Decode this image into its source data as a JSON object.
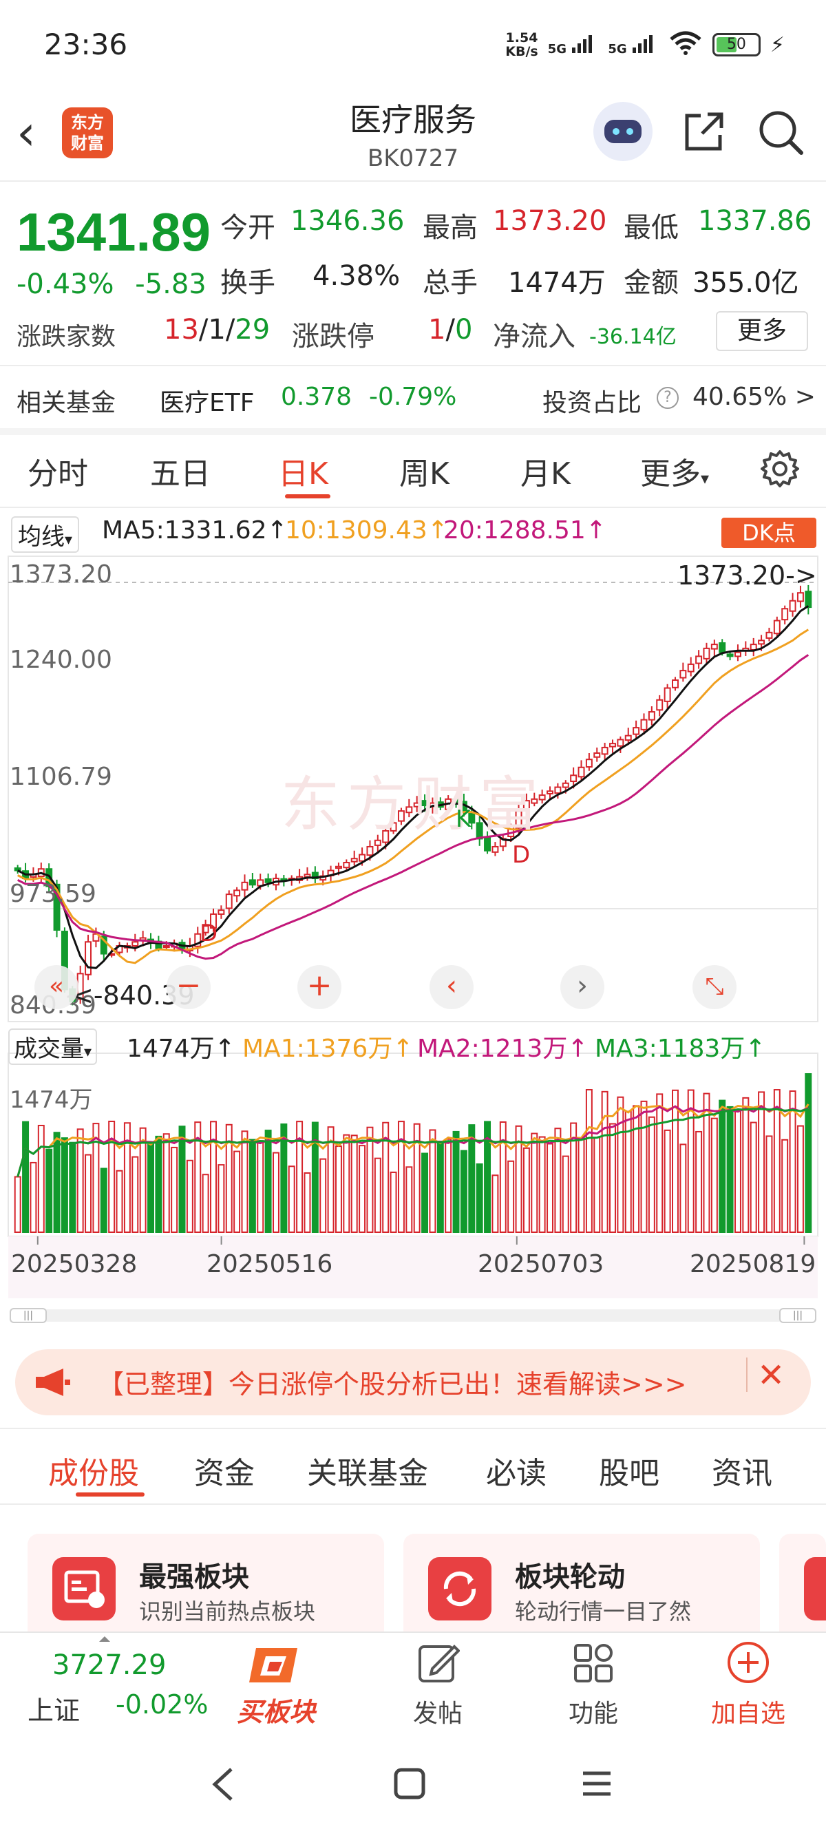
{
  "status_bar": {
    "time": "23:36",
    "net_speed_value": "1.54",
    "net_speed_unit": "KB/s",
    "signal1": "5G",
    "signal2": "5G",
    "battery": "50"
  },
  "header": {
    "logo_line1": "东方",
    "logo_line2": "财富",
    "title": "医疗服务",
    "code": "BK0727"
  },
  "quote": {
    "price": "1341.89",
    "change_pct": "-0.43%",
    "change_abs": "-5.83",
    "open_label": "今开",
    "open": "1346.36",
    "high_label": "最高",
    "high": "1373.20",
    "low_label": "最低",
    "low": "1337.86",
    "turnover_label": "换手",
    "turnover": "4.38%",
    "volume_label": "总手",
    "volume": "1474万",
    "amount_label": "金额",
    "amount": "355.0亿",
    "breadth_label": "涨跌家数",
    "breadth_up": "13",
    "breadth_flat": "1",
    "breadth_down": "29",
    "limit_label": "涨跌停",
    "limit_up": "1",
    "limit_down": "0",
    "netflow_label": "净流入",
    "netflow": "-36.14亿",
    "more_button": "更多"
  },
  "fund": {
    "label": "相关基金",
    "name": "医疗ETF",
    "price": "0.378",
    "change": "-0.79%",
    "ratio_label": "投资占比",
    "ratio": "40.65%",
    "chevron": ">"
  },
  "period_tabs": [
    "分时",
    "五日",
    "日K",
    "周K",
    "月K",
    "更多"
  ],
  "ma": {
    "type": "均线",
    "ma5": "MA5:1331.62",
    "ma10": "10:1309.43",
    "ma20": "20:1288.51",
    "dk_button": "DK点",
    "colors": {
      "ma5": "#111111",
      "ma10": "#f0a020",
      "ma20": "#c2187a"
    }
  },
  "price_axis": [
    "1373.20",
    "1240.00",
    "1106.79",
    "973.59",
    "840.39"
  ],
  "chart_annotations": {
    "high_marker": "1373.20->",
    "low_marker": "<-840.39",
    "k_marker": "K",
    "d_marker1": "D",
    "d_marker2": "D",
    "watermark": "东方财富"
  },
  "volume": {
    "label": "成交量",
    "value": "1474万",
    "ma1": "MA1:1376万",
    "ma2": "MA2:1213万",
    "ma3": "MA3:1183万",
    "axis_top": "1474万",
    "colors": {
      "ma1": "#f0a020",
      "ma2": "#c2187a",
      "ma3": "#119a2d"
    }
  },
  "date_axis": [
    "20250328",
    "20250516",
    "20250703",
    "20250819"
  ],
  "banner": {
    "text": "【已整理】今日涨停个股分析已出！速看解读>>>"
  },
  "bottom_tabs": [
    "成份股",
    "资金",
    "关联基金",
    "必读",
    "股吧",
    "资讯"
  ],
  "cards": [
    {
      "title": "最强板块",
      "desc": "识别当前热点板块"
    },
    {
      "title": "板块轮动",
      "desc": "轮动行情一目了然"
    }
  ],
  "toolbar": {
    "index_value": "3727.29",
    "index_name": "上证",
    "index_change": "-0.02%",
    "buy_label": "买板块",
    "post_label": "发帖",
    "func_label": "功能",
    "add_label": "加自选"
  },
  "chart_data": {
    "type": "candlestick",
    "title": "医疗服务 日K",
    "y_axis_ticks": [
      1373.2,
      1240.0,
      1106.79,
      973.59,
      840.39
    ],
    "ylim": [
      840.39,
      1373.2
    ],
    "x_tick_labels": [
      "20250328",
      "20250516",
      "20250703",
      "20250819"
    ],
    "close_approx": [
      1010,
      1000,
      1005,
      1012,
      990,
      935,
      860,
      845,
      880,
      920,
      930,
      905,
      905,
      915,
      915,
      920,
      925,
      920,
      912,
      915,
      918,
      912,
      915,
      930,
      940,
      955,
      960,
      980,
      985,
      995,
      992,
      998,
      995,
      1000,
      998,
      1000,
      1002,
      1005,
      1000,
      1003,
      1010,
      1015,
      1020,
      1025,
      1030,
      1040,
      1048,
      1060,
      1070,
      1085,
      1090,
      1095,
      1092,
      1095,
      1090,
      1100,
      1095,
      1085,
      1070,
      1050,
      1035,
      1040,
      1050,
      1065,
      1085,
      1098,
      1100,
      1105,
      1110,
      1115,
      1120,
      1130,
      1140,
      1150,
      1158,
      1165,
      1170,
      1175,
      1180,
      1190,
      1200,
      1210,
      1225,
      1240,
      1250,
      1262,
      1270,
      1280,
      1290,
      1295,
      1285,
      1280,
      1285,
      1290,
      1295,
      1300,
      1310,
      1325,
      1340,
      1350,
      1360,
      1341.89
    ],
    "high": 1373.2,
    "low": 840.39,
    "volume_last": "1474万"
  }
}
